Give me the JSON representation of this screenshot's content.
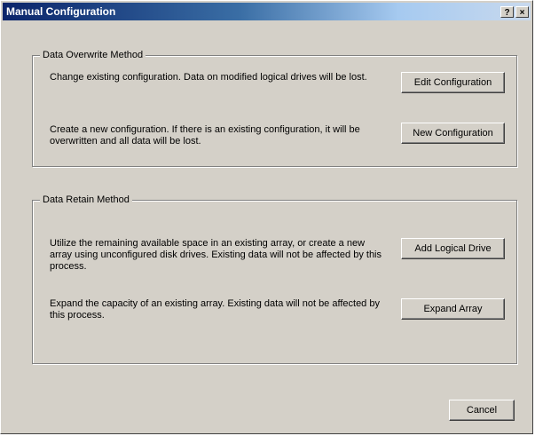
{
  "window": {
    "title": "Manual Configuration",
    "help_label": "?",
    "close_label": "×"
  },
  "overwrite": {
    "legend": "Data Overwrite Method",
    "edit_desc": "Change existing configuration. Data on  modified logical drives will be lost.",
    "edit_button": "Edit Configuration",
    "new_desc": "Create a new configuration. If there is an existing configuration, it will be overwritten and all data will be lost.",
    "new_button": "New Configuration"
  },
  "retain": {
    "legend": "Data Retain Method",
    "add_desc": "Utilize the remaining available space in an existing array, or create a new array using unconfigured disk drives. Existing data will not be affected by this process.",
    "add_button": "Add Logical Drive",
    "expand_desc": "Expand the capacity of an existing array. Existing data will not be affected by this process.",
    "expand_button": "Expand Array"
  },
  "footer": {
    "cancel_button": "Cancel"
  },
  "colors": {
    "face": "#d4d0c8",
    "title_start": "#0a246a",
    "title_end": "#a6caf0"
  }
}
